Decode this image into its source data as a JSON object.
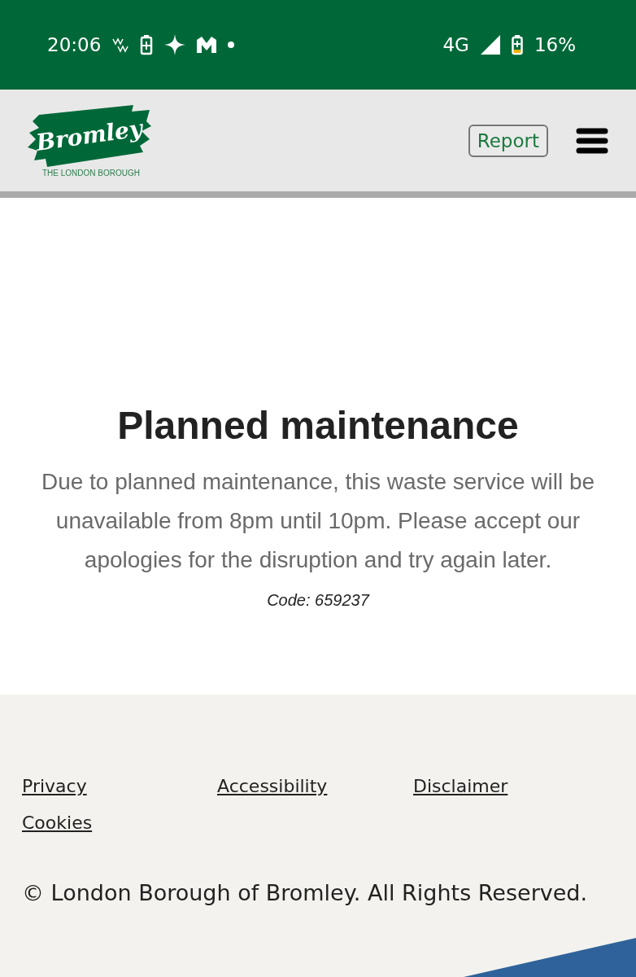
{
  "status_bar": {
    "time": "20:06",
    "network": "4G",
    "battery": "16%"
  },
  "header": {
    "logo_text": "Bromley",
    "logo_subtitle": "THE LONDON BOROUGH",
    "report_button": "Report"
  },
  "main": {
    "title": "Planned maintenance",
    "message": "Due to planned maintenance, this waste service will be unavailable from 8pm until 10pm. Please accept our apologies for the disruption and try again later.",
    "code": "Code: 659237"
  },
  "footer": {
    "links": [
      "Privacy",
      "Accessibility",
      "Disclaimer",
      "Cookies"
    ],
    "copyright": "© London Borough of Bromley. All Rights Reserved."
  }
}
